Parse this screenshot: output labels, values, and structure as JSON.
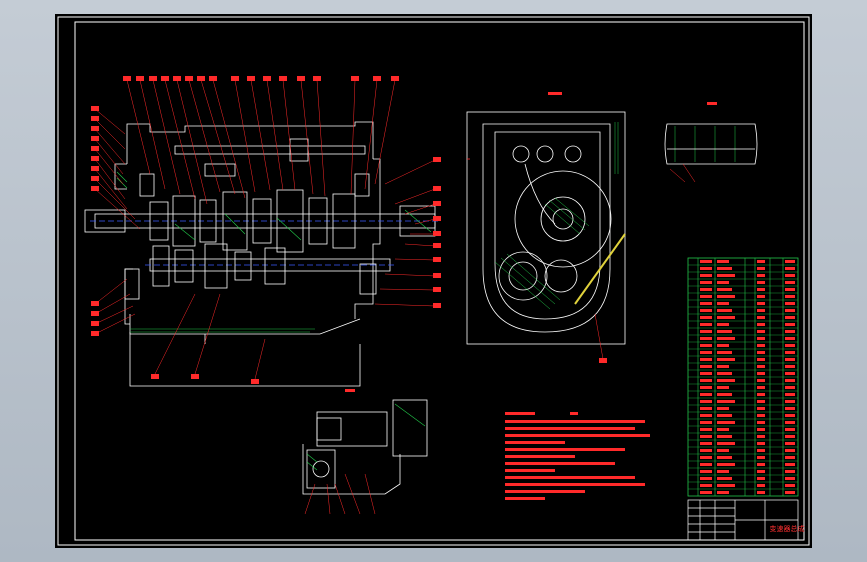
{
  "drawing": {
    "title_block_name": "变速器总成"
  },
  "colors": {
    "background_sheet": "#000000",
    "frame_lines": "#ffffff",
    "outline": "#ffffff",
    "leader_red": "#ff2a2a",
    "hatch_green": "#22c84a",
    "center_blue": "#3a5cff",
    "yellow_note": "#e0d23c"
  },
  "views": [
    {
      "name": "main-section-view"
    },
    {
      "name": "side-section-view"
    },
    {
      "name": "detail-view"
    },
    {
      "name": "bottom-partial-view"
    },
    {
      "name": "technical-notes"
    },
    {
      "name": "parts-list"
    },
    {
      "name": "title-block"
    }
  ]
}
